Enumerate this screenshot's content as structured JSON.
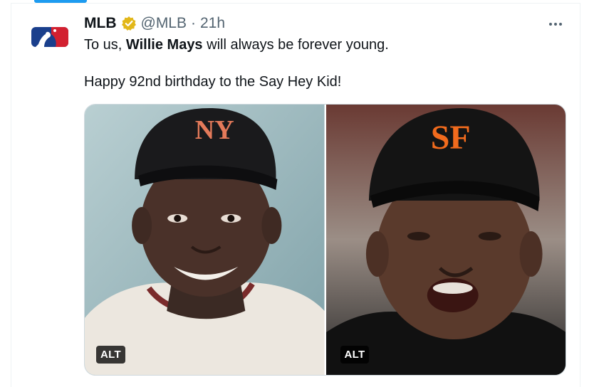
{
  "tweet": {
    "author_name": "MLB",
    "handle": "@MLB",
    "separator": "·",
    "time": "21h",
    "text_prefix": "To us, ",
    "text_bold": "Willie Mays",
    "text_suffix": " will always be forever young.",
    "text_line2": "Happy 92nd birthday to the Say Hey Kid!",
    "verified_color": "#e2b719",
    "icons": {
      "avatar": "mlb-logo-icon",
      "verified": "verified-badge-icon",
      "more": "more-options-icon"
    }
  },
  "media": [
    {
      "alt_label": "ALT",
      "cap_logo": "NY"
    },
    {
      "alt_label": "ALT",
      "cap_logo": "SF"
    }
  ],
  "colors": {
    "accent": "#1d9bf0",
    "text": "#0f1419",
    "secondary": "#536471",
    "mlb_blue": "#1a3f8c",
    "mlb_red": "#d22030"
  }
}
